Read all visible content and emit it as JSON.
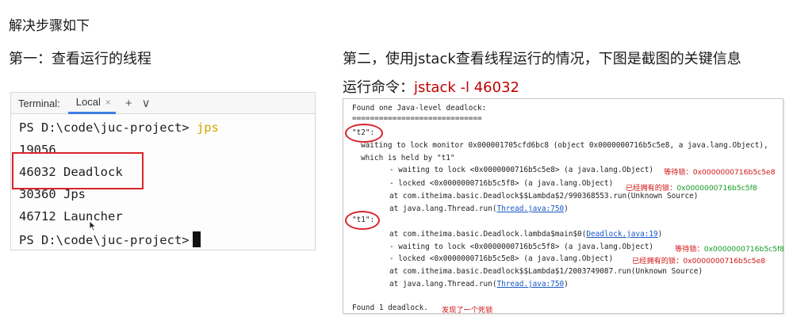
{
  "page_title": "解决步骤如下",
  "step1": {
    "title": "第一：查看运行的线程"
  },
  "step2": {
    "title": "第二，使用jstack查看线程运行的情况，下图是截图的关键信息",
    "run_label": "运行命令：",
    "run_command": "jstack -l 46032"
  },
  "terminal": {
    "label": "Terminal:",
    "tab_label": "Local",
    "tab_close": "×",
    "add_button": "+",
    "dropdown_button": "∨",
    "prompt": "PS D:\\code\\juc-project> ",
    "command": "jps",
    "lines": [
      "19056",
      "46032 Deadlock",
      "30360 Jps",
      "46712 Launcher"
    ],
    "final_prompt": "PS D:\\code\\juc-project>"
  },
  "dump": {
    "header": "Found one Java-level deadlock:",
    "separator": "=============================",
    "t2": {
      "name": "\"t2\":",
      "waiting_line": "waiting to lock monitor 0x000001705cfd6bc8 (object 0x0000000716b5c5e8, a java.lang.Object),",
      "held_line": "which is held by \"t1\"",
      "wait_lock": "- waiting to lock <0x0000000716b5c5e8> (a java.lang.Object)",
      "wait_note_label": "等待锁：",
      "wait_note_value": "0x0000000716b5c5e8",
      "locked": "- locked <0x0000000716b5c5f8> (a java.lang.Object)",
      "locked_note_label": "已经拥有的锁：",
      "locked_note_value": "0x0000000716b5c5f8",
      "at1": "at com.itheima.basic.Deadlock$$Lambda$2/990368553.run(Unknown Source)",
      "at2_prefix": "at java.lang.Thread.run(",
      "at2_link": "Thread.java:750",
      "at2_suffix": ")"
    },
    "t1": {
      "name": "\"t1\":",
      "at0_prefix": "at com.itheima.basic.Deadlock.lambda$main$0(",
      "at0_link": "Deadlock.java:19",
      "at0_suffix": ")",
      "wait_lock": "- waiting to lock <0x0000000716b5c5f8> (a java.lang.Object)",
      "wait_note_label": "等待锁：",
      "wait_note_value": "0x0000000716b5c5f8",
      "locked": "- locked <0x0000000716b5c5e8> (a java.lang.Object)",
      "locked_note_label": "已经拥有的锁：",
      "locked_note_value": "0x0000000716b5c5e8",
      "at1": "at com.itheima.basic.Deadlock$$Lambda$1/2003749087.run(Unknown Source)",
      "at2_prefix": "at java.lang.Thread.run(",
      "at2_link": "Thread.java:750",
      "at2_suffix": ")"
    },
    "footer": "Found 1 deadlock.",
    "footer_note": "发现了一个死锁"
  },
  "colors": {
    "highlight_red": "#d9242b",
    "command_red": "#c00000",
    "note_red": "#d01414",
    "note_green": "#129a1f",
    "link_blue": "#1a57c5",
    "jps_yellow": "#d8a400"
  }
}
